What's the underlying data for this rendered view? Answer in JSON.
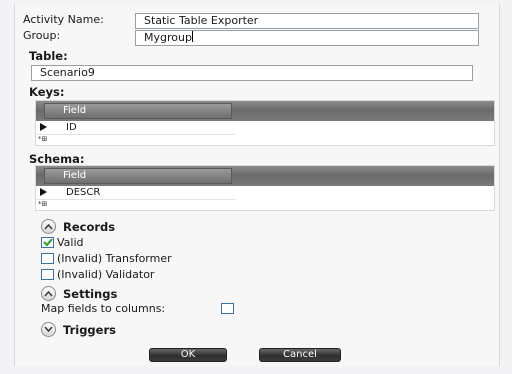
{
  "form": {
    "activity_name_label": "Activity Name:",
    "activity_name_value": "Static Table Exporter",
    "group_label": "Group:",
    "group_value": "Mygroup",
    "table_heading": "Table:",
    "table_value": "Scenario9"
  },
  "keys": {
    "heading": "Keys:",
    "column_header": "Field",
    "rows": [
      "ID"
    ],
    "new_row_marker": "*⊞"
  },
  "schema": {
    "heading": "Schema:",
    "column_header": "Field",
    "rows": [
      "DESCR"
    ],
    "new_row_marker": "*⊞"
  },
  "records": {
    "heading": "Records",
    "items": [
      {
        "label": "Valid",
        "checked": true
      },
      {
        "label": "(Invalid) Transformer",
        "checked": false
      },
      {
        "label": "(Invalid) Validator",
        "checked": false
      }
    ]
  },
  "settings": {
    "heading": "Settings",
    "map_fields_label": "Map fields to columns:",
    "map_fields_checked": false
  },
  "triggers": {
    "heading": "Triggers"
  },
  "buttons": {
    "ok": "OK",
    "cancel": "Cancel"
  },
  "colors": {
    "checkbox_border": "#3d6fa8",
    "check_mark": "#2e9c2e",
    "grid_header": "#7a7a7a",
    "button_bg": "#3c3c3c"
  },
  "icons": {
    "row_pointer": "triangle-right-icon",
    "collapse": "chevron-up-icon",
    "expand": "chevron-down-icon",
    "check": "checkmark-icon"
  }
}
